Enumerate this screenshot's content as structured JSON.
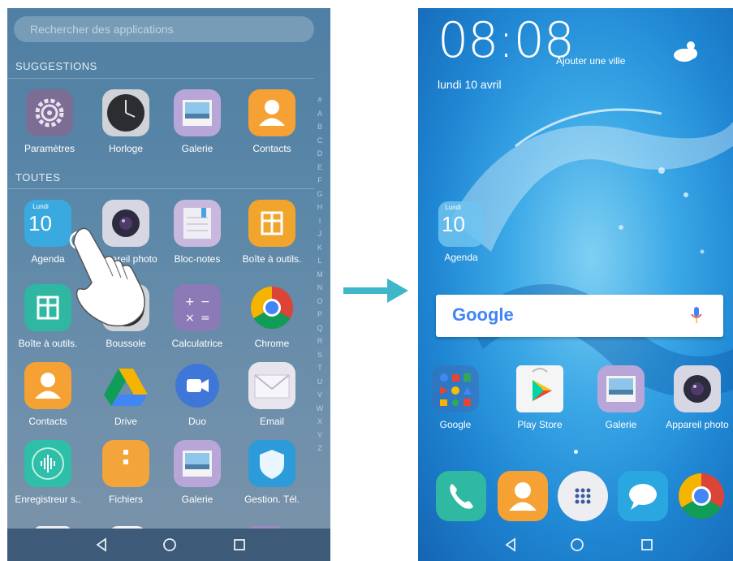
{
  "left_screen": {
    "search_placeholder": "Rechercher des applications",
    "suggestions_title": "SUGGESTIONS",
    "all_title": "TOUTES",
    "suggestions": [
      {
        "label": "Paramètres",
        "icon": "settings-icon"
      },
      {
        "label": "Horloge",
        "icon": "clock-icon"
      },
      {
        "label": "Galerie",
        "icon": "gallery-icon"
      },
      {
        "label": "Contacts",
        "icon": "contacts-icon"
      }
    ],
    "apps": [
      {
        "label": "Agenda",
        "icon": "calendar-icon",
        "badge_top": "Lundi",
        "badge_num": "10"
      },
      {
        "label": "Appareil photo",
        "icon": "camera-icon"
      },
      {
        "label": "Bloc-notes",
        "icon": "notepad-icon"
      },
      {
        "label": "Boîte à outils.",
        "icon": "toolbox-icon"
      },
      {
        "label": "Boîte à outils.",
        "icon": "toolbox-icon"
      },
      {
        "label": "Boussole",
        "icon": "compass-icon"
      },
      {
        "label": "Calculatrice",
        "icon": "calculator-icon"
      },
      {
        "label": "Chrome",
        "icon": "chrome-icon"
      },
      {
        "label": "Contacts",
        "icon": "contacts-icon"
      },
      {
        "label": "Drive",
        "icon": "drive-icon"
      },
      {
        "label": "Duo",
        "icon": "duo-icon"
      },
      {
        "label": "Email",
        "icon": "email-icon"
      },
      {
        "label": "Enregistreur s..",
        "icon": "recorder-icon"
      },
      {
        "label": "Fichiers",
        "icon": "files-icon"
      },
      {
        "label": "Galerie",
        "icon": "gallery-icon"
      },
      {
        "label": "Gestion. Tél.",
        "icon": "phone-manager-icon"
      }
    ],
    "alphabet": [
      "#",
      "A",
      "B",
      "C",
      "D",
      "E",
      "F",
      "G",
      "H",
      "I",
      "J",
      "K",
      "L",
      "M",
      "N",
      "O",
      "P",
      "Q",
      "R",
      "S",
      "T",
      "U",
      "V",
      "W",
      "X",
      "Y",
      "Z"
    ]
  },
  "right_screen": {
    "time": "08:08",
    "add_city": "Ajouter une ville",
    "date": "lundi 10 avril",
    "agenda_badge_top": "Lundi",
    "agenda_badge_num": "10",
    "agenda_label": "Agenda",
    "google_logo": "Google",
    "home_apps": [
      {
        "label": "Google",
        "icon": "google-folder-icon"
      },
      {
        "label": "Play Store",
        "icon": "play-store-icon"
      },
      {
        "label": "Galerie",
        "icon": "gallery-icon"
      },
      {
        "label": "Appareil photo",
        "icon": "camera-icon"
      }
    ],
    "dock": [
      {
        "icon": "phone-icon"
      },
      {
        "icon": "contacts-icon"
      },
      {
        "icon": "app-drawer-icon"
      },
      {
        "icon": "messages-icon"
      },
      {
        "icon": "chrome-icon"
      }
    ]
  },
  "colors": {
    "accent_arrow": "#3fb7c9",
    "nav_bg": "#3d5a78"
  }
}
